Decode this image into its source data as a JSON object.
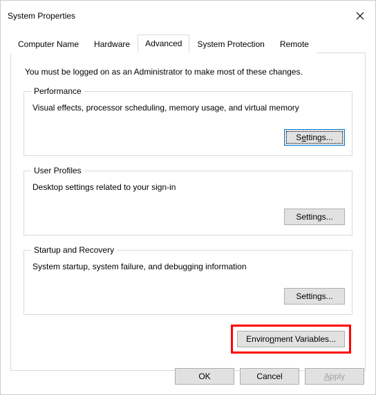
{
  "window": {
    "title": "System Properties"
  },
  "tabs": {
    "computer_name": "Computer Name",
    "hardware": "Hardware",
    "advanced": "Advanced",
    "system_protection": "System Protection",
    "remote": "Remote",
    "active": "advanced"
  },
  "advanced": {
    "intro": "You must be logged on as an Administrator to make most of these changes.",
    "performance": {
      "legend": "Performance",
      "desc": "Visual effects, processor scheduling, memory usage, and virtual memory",
      "button_pre": "S",
      "button_u": "e",
      "button_post": "ttings..."
    },
    "user_profiles": {
      "legend": "User Profiles",
      "desc": "Desktop settings related to your sign-in",
      "button": "Settings..."
    },
    "startup": {
      "legend": "Startup and Recovery",
      "desc": "System startup, system failure, and debugging information",
      "button": "Settings..."
    },
    "env": {
      "pre": "Enviro",
      "u": "n",
      "post": "ment Variables..."
    }
  },
  "footer": {
    "ok": "OK",
    "cancel": "Cancel",
    "apply_u": "A",
    "apply_post": "pply"
  },
  "highlight": {
    "color": "#ff0000"
  }
}
